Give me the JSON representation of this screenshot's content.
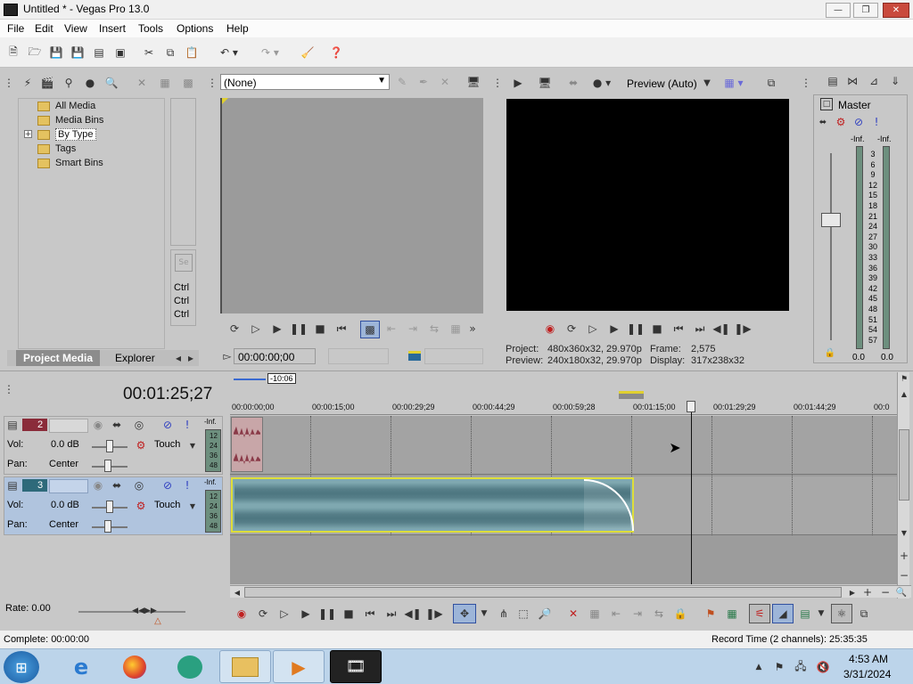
{
  "window": {
    "title": "Untitled * - Vegas Pro 13.0"
  },
  "menu": [
    "File",
    "Edit",
    "View",
    "Insert",
    "Tools",
    "Options",
    "Help"
  ],
  "project_media": {
    "tree": [
      "All Media",
      "Media Bins",
      "By Type",
      "Tags",
      "Smart Bins"
    ],
    "tabs": [
      "Project Media",
      "Explorer"
    ]
  },
  "trimmer": {
    "select": "(None)",
    "ctrl_labels": [
      "Ctrl",
      "Ctrl",
      "Ctrl"
    ],
    "timecode": "00:00:00;00"
  },
  "preview": {
    "mode": "Preview (Auto)",
    "project_label": "Project:",
    "project_value": "480x360x32, 29.970p",
    "frame_label": "Frame:",
    "frame_value": "2,575",
    "preview_label": "Preview:",
    "preview_value": "240x180x32, 29.970p",
    "display_label": "Display:",
    "display_value": "317x238x32"
  },
  "master": {
    "label": "Master",
    "inf_left": "-Inf.",
    "inf_right": "-Inf.",
    "scale": [
      "3",
      "6",
      "9",
      "12",
      "15",
      "18",
      "21",
      "24",
      "27",
      "30",
      "33",
      "36",
      "39",
      "42",
      "45",
      "48",
      "51",
      "54",
      "57"
    ],
    "bottom_left": "0.0",
    "bottom_right": "0.0"
  },
  "timeline": {
    "current_time": "00:01:25;27",
    "loop_badge": "-10:06",
    "ruler": [
      "00:00:00;00",
      "00:00:15;00",
      "00:00:29;29",
      "00:00:44;29",
      "00:00:59;28",
      "00:01:15;00",
      "00:01:29;29",
      "00:01:44;29",
      "00:0"
    ],
    "tracks": [
      {
        "number": "2",
        "vol_label": "Vol:",
        "vol_value": "0.0 dB",
        "touch": "Touch",
        "pan_label": "Pan:",
        "pan_value": "Center",
        "meter_inf": "-Inf.",
        "meter_scale": [
          "12",
          "24",
          "36",
          "48"
        ]
      },
      {
        "number": "3",
        "vol_label": "Vol:",
        "vol_value": "0.0 dB",
        "touch": "Touch",
        "pan_label": "Pan:",
        "pan_value": "Center",
        "meter_inf": "-Inf.",
        "meter_scale": [
          "12",
          "24",
          "36",
          "48"
        ]
      }
    ],
    "rate": "Rate: 0.00"
  },
  "status": {
    "complete": "Complete: 00:00:00",
    "record_time": "Record Time (2 channels): 25:35:35"
  },
  "taskbar": {
    "time": "4:53 AM",
    "date": "3/31/2024"
  }
}
